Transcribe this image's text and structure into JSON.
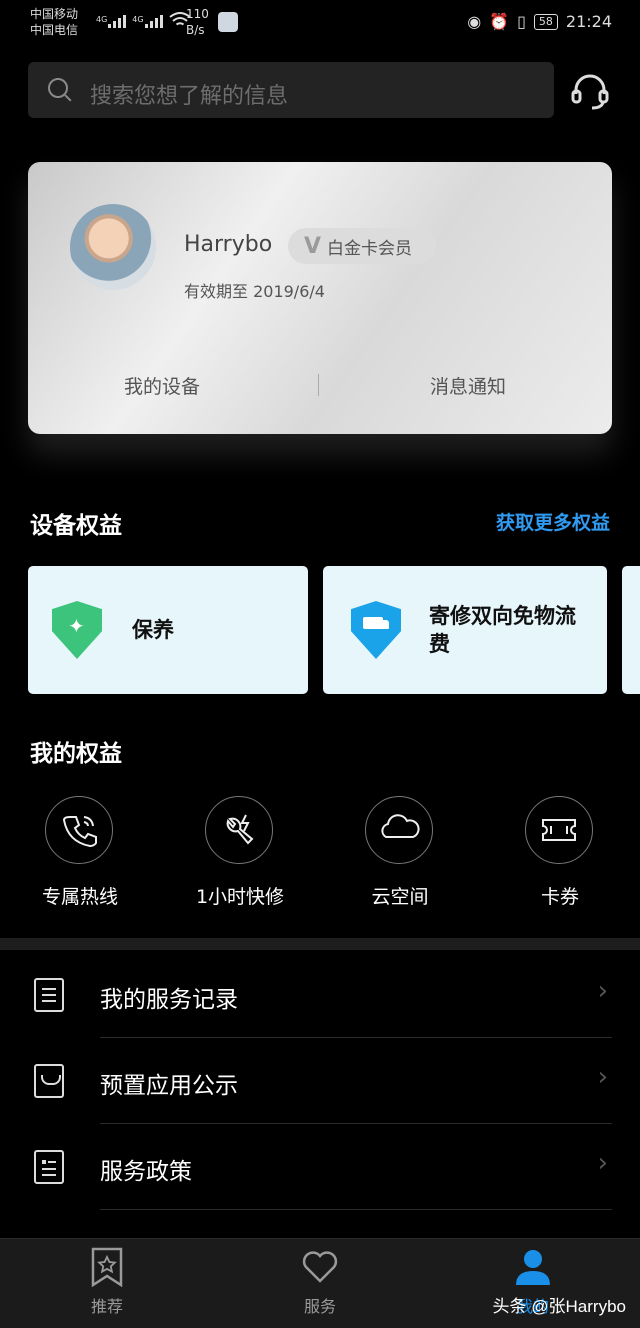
{
  "status_bar": {
    "carrier1": "中国移动",
    "carrier2": "中国电信",
    "net1": "4G",
    "net2": "4G",
    "speed_value": "110",
    "speed_unit": "B/s",
    "battery": "58",
    "time": "21:24"
  },
  "search": {
    "placeholder": "搜索您想了解的信息"
  },
  "member_card": {
    "username": "Harrybo",
    "tier": "白金卡会员",
    "validity": "有效期至 2019/6/4",
    "my_devices": "我的设备",
    "notifications": "消息通知"
  },
  "device_benefits": {
    "title": "设备权益",
    "more_link": "获取更多权益",
    "items": [
      {
        "label": "保养",
        "icon": "shield-sparkle-icon",
        "color": "#3cc47c"
      },
      {
        "label": "寄修双向免物流费",
        "icon": "shield-truck-icon",
        "color": "#1aa3e8"
      }
    ]
  },
  "my_rights": {
    "title": "我的权益",
    "items": [
      {
        "label": "专属热线",
        "icon": "phone-icon"
      },
      {
        "label": "1小时快修",
        "icon": "repair-icon"
      },
      {
        "label": "云空间",
        "icon": "cloud-icon"
      },
      {
        "label": "卡券",
        "icon": "ticket-icon"
      }
    ]
  },
  "menu": [
    {
      "label": "我的服务记录",
      "icon": "document-icon"
    },
    {
      "label": "预置应用公示",
      "icon": "inbox-icon"
    },
    {
      "label": "服务政策",
      "icon": "policy-icon"
    }
  ],
  "bottom_nav": {
    "items": [
      {
        "label": "推荐",
        "icon": "star-bookmark-icon"
      },
      {
        "label": "服务",
        "icon": "heart-icon"
      },
      {
        "label": "我的",
        "icon": "person-icon"
      }
    ],
    "active_color": "#1a8fe8"
  },
  "watermark": "头条 @张Harrybo"
}
